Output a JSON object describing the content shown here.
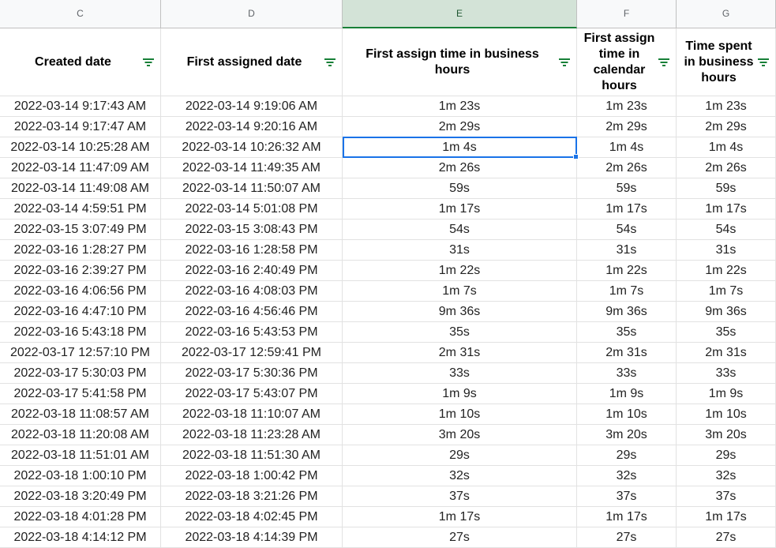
{
  "columns": [
    {
      "letter": "C",
      "header": "Created date",
      "selected": false
    },
    {
      "letter": "D",
      "header": "First assigned date",
      "selected": false
    },
    {
      "letter": "E",
      "header": "First assign time in business hours",
      "selected": true
    },
    {
      "letter": "F",
      "header": "First assign time in calendar hours",
      "selected": false
    },
    {
      "letter": "G",
      "header": "Time spent in business hours",
      "selected": false
    }
  ],
  "rows": [
    [
      "2022-03-14 9:17:43 AM",
      "2022-03-14 9:19:06 AM",
      "1m 23s",
      "1m 23s",
      "1m 23s"
    ],
    [
      "2022-03-14 9:17:47 AM",
      "2022-03-14 9:20:16 AM",
      "2m 29s",
      "2m 29s",
      "2m 29s"
    ],
    [
      "2022-03-14 10:25:28 AM",
      "2022-03-14 10:26:32 AM",
      "1m 4s",
      "1m 4s",
      "1m 4s"
    ],
    [
      "2022-03-14 11:47:09 AM",
      "2022-03-14 11:49:35 AM",
      "2m 26s",
      "2m 26s",
      "2m 26s"
    ],
    [
      "2022-03-14 11:49:08 AM",
      "2022-03-14 11:50:07 AM",
      "59s",
      "59s",
      "59s"
    ],
    [
      "2022-03-14 4:59:51 PM",
      "2022-03-14 5:01:08 PM",
      "1m 17s",
      "1m 17s",
      "1m 17s"
    ],
    [
      "2022-03-15 3:07:49 PM",
      "2022-03-15 3:08:43 PM",
      "54s",
      "54s",
      "54s"
    ],
    [
      "2022-03-16 1:28:27 PM",
      "2022-03-16 1:28:58 PM",
      "31s",
      "31s",
      "31s"
    ],
    [
      "2022-03-16 2:39:27 PM",
      "2022-03-16 2:40:49 PM",
      "1m 22s",
      "1m 22s",
      "1m 22s"
    ],
    [
      "2022-03-16 4:06:56 PM",
      "2022-03-16 4:08:03 PM",
      "1m 7s",
      "1m 7s",
      "1m 7s"
    ],
    [
      "2022-03-16 4:47:10 PM",
      "2022-03-16 4:56:46 PM",
      "9m 36s",
      "9m 36s",
      "9m 36s"
    ],
    [
      "2022-03-16 5:43:18 PM",
      "2022-03-16 5:43:53 PM",
      "35s",
      "35s",
      "35s"
    ],
    [
      "2022-03-17 12:57:10 PM",
      "2022-03-17 12:59:41 PM",
      "2m 31s",
      "2m 31s",
      "2m 31s"
    ],
    [
      "2022-03-17 5:30:03 PM",
      "2022-03-17 5:30:36 PM",
      "33s",
      "33s",
      "33s"
    ],
    [
      "2022-03-17 5:41:58 PM",
      "2022-03-17 5:43:07 PM",
      "1m 9s",
      "1m 9s",
      "1m 9s"
    ],
    [
      "2022-03-18 11:08:57 AM",
      "2022-03-18 11:10:07 AM",
      "1m 10s",
      "1m 10s",
      "1m 10s"
    ],
    [
      "2022-03-18 11:20:08 AM",
      "2022-03-18 11:23:28 AM",
      "3m 20s",
      "3m 20s",
      "3m 20s"
    ],
    [
      "2022-03-18 11:51:01 AM",
      "2022-03-18 11:51:30 AM",
      "29s",
      "29s",
      "29s"
    ],
    [
      "2022-03-18 1:00:10 PM",
      "2022-03-18 1:00:42 PM",
      "32s",
      "32s",
      "32s"
    ],
    [
      "2022-03-18 3:20:49 PM",
      "2022-03-18 3:21:26 PM",
      "37s",
      "37s",
      "37s"
    ],
    [
      "2022-03-18 4:01:28 PM",
      "2022-03-18 4:02:45 PM",
      "1m 17s",
      "1m 17s",
      "1m 17s"
    ],
    [
      "2022-03-18 4:14:12 PM",
      "2022-03-18 4:14:39 PM",
      "27s",
      "27s",
      "27s"
    ]
  ],
  "selected_cell": {
    "column": "E",
    "value": "1m 4s"
  },
  "colors": {
    "filter_icon": "#188038",
    "selection": "#1a73e8",
    "selected_header_bg": "#d3e3d7"
  }
}
